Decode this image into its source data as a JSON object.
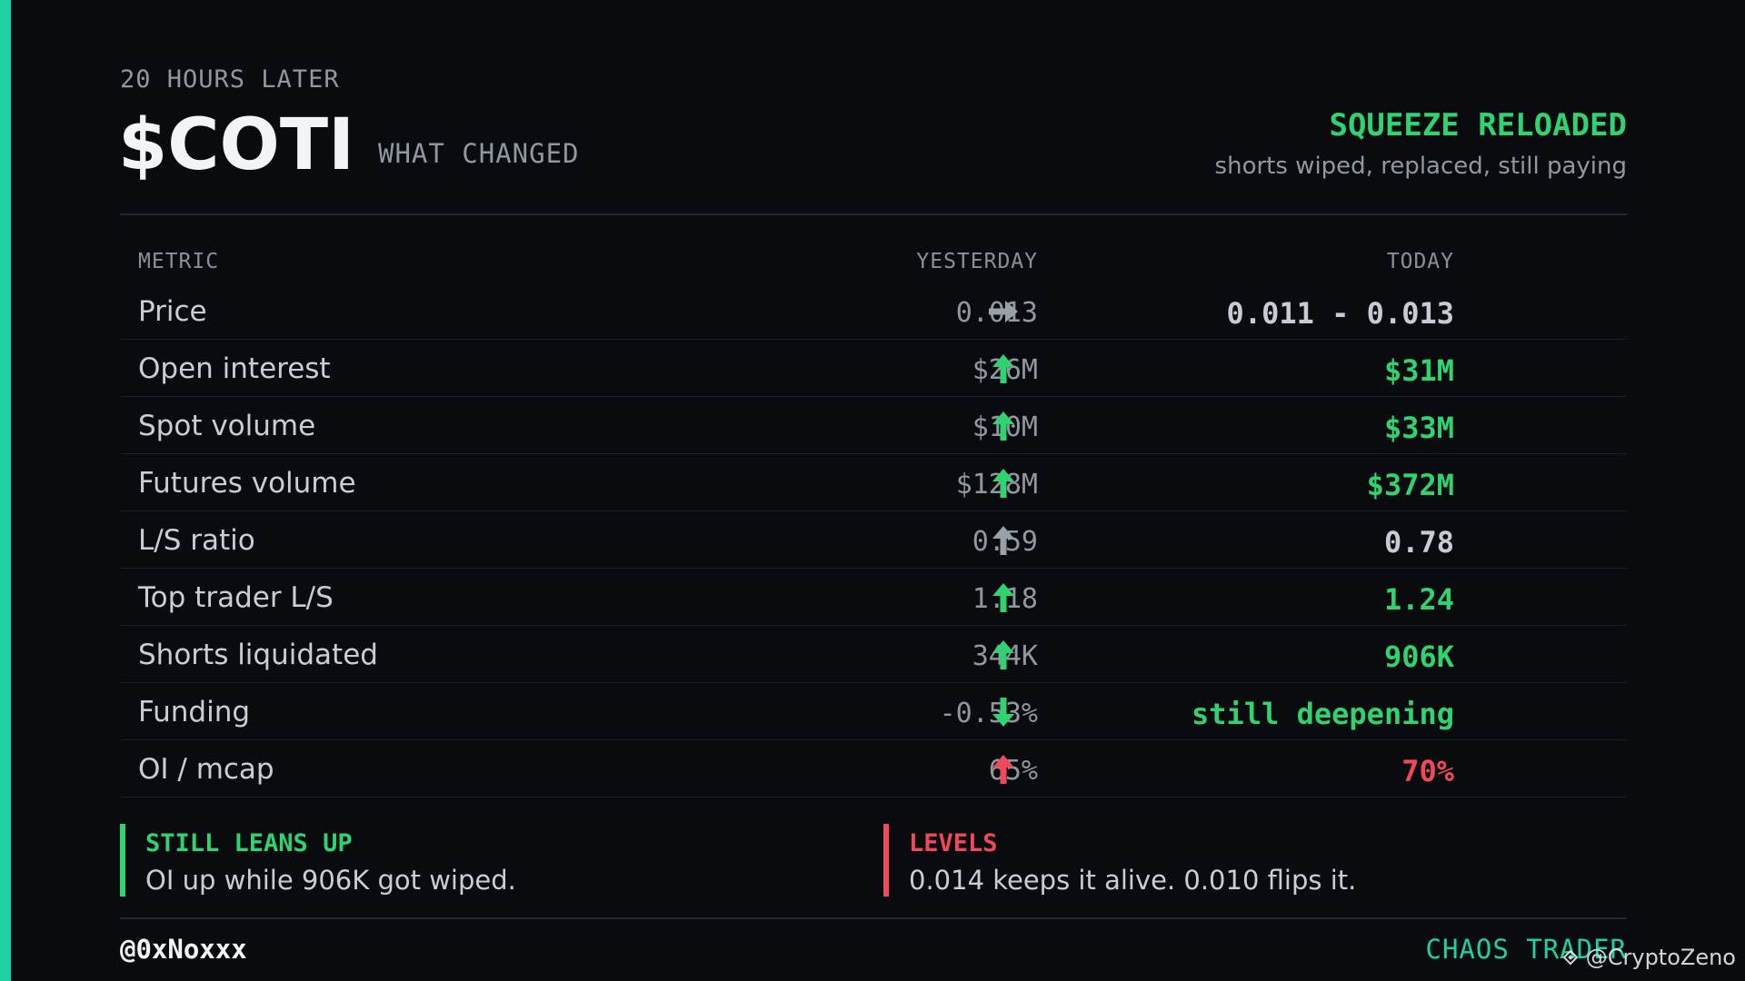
{
  "header": {
    "kicker": "20 HOURS LATER",
    "ticker": "$COTI",
    "subtitle": "WHAT CHANGED",
    "headline": "SQUEEZE RELOADED",
    "tagline": "shorts wiped, replaced, still paying"
  },
  "table": {
    "headers": {
      "metric": "METRIC",
      "yesterday": "YESTERDAY",
      "today": "TODAY"
    },
    "rows": [
      {
        "metric": "Price",
        "yesterday": "0.013",
        "arrow": "right",
        "arrow_color": "#9aa0a8",
        "today": "0.011 - 0.013",
        "today_color": "#c7ccd4"
      },
      {
        "metric": "Open interest",
        "yesterday": "$26M",
        "arrow": "up",
        "arrow_color": "#2fd36f",
        "today": "$31M",
        "today_color": "#2fd36f"
      },
      {
        "metric": "Spot volume",
        "yesterday": "$10M",
        "arrow": "up",
        "arrow_color": "#2fd36f",
        "today": "$33M",
        "today_color": "#2fd36f"
      },
      {
        "metric": "Futures volume",
        "yesterday": "$128M",
        "arrow": "up",
        "arrow_color": "#2fd36f",
        "today": "$372M",
        "today_color": "#2fd36f"
      },
      {
        "metric": "L/S ratio",
        "yesterday": "0.59",
        "arrow": "up",
        "arrow_color": "#9aa0a8",
        "today": "0.78",
        "today_color": "#c7ccd4"
      },
      {
        "metric": "Top trader L/S",
        "yesterday": "1.18",
        "arrow": "up",
        "arrow_color": "#2fd36f",
        "today": "1.24",
        "today_color": "#2fd36f"
      },
      {
        "metric": "Shorts liquidated",
        "yesterday": "344K",
        "arrow": "up",
        "arrow_color": "#2fd36f",
        "today": "906K",
        "today_color": "#2fd36f"
      },
      {
        "metric": "Funding",
        "yesterday": "-0.53%",
        "arrow": "down",
        "arrow_color": "#2fd36f",
        "today": "still deepening",
        "today_color": "#2fd36f"
      },
      {
        "metric": "OI / mcap",
        "yesterday": "65%",
        "arrow": "up",
        "arrow_color": "#f0495a",
        "today": "70%",
        "today_color": "#f0495a"
      }
    ]
  },
  "callouts": [
    {
      "title": "STILL LEANS UP",
      "body": "OI up while 906K got wiped.",
      "color": "#2fd36f"
    },
    {
      "title": "LEVELS",
      "body": "0.014 keeps it alive. 0.010 flips it.",
      "color": "#f0495a"
    }
  ],
  "footer": {
    "handle": "@0xNoxxx",
    "brand": "CHAOS TRADER",
    "watermark": "@CryptoZeno",
    "watermark_icon": "binance-diamond-icon"
  },
  "colors": {
    "accent": "#1fd1a0",
    "positive": "#2fd36f",
    "negative": "#f0495a",
    "neutral": "#9aa0a8",
    "background": "#0a0b0e"
  }
}
